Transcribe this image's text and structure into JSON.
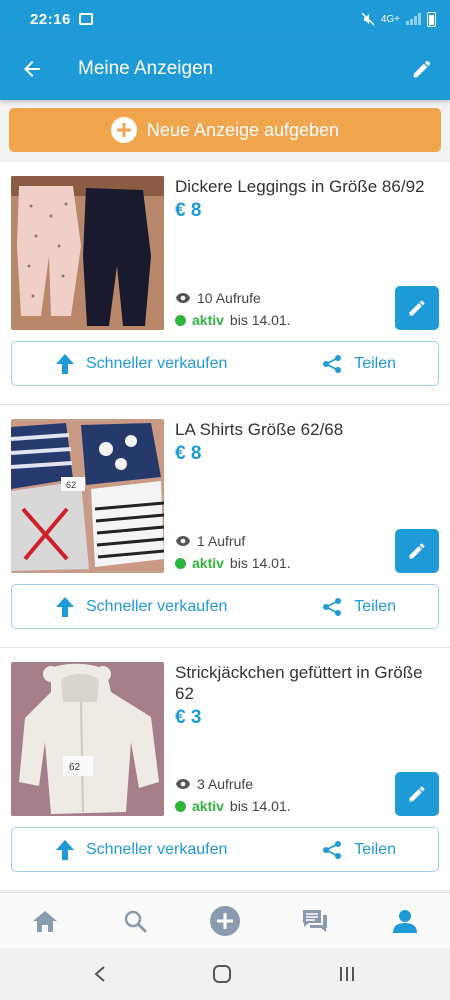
{
  "status_bar": {
    "time": "22:16",
    "network": "4G+"
  },
  "app_bar": {
    "title": "Meine Anzeigen"
  },
  "new_ad_button": {
    "label": "Neue Anzeige aufgeben"
  },
  "colors": {
    "primary": "#1e9ad6",
    "accent_orange": "#f0a44b",
    "active_green": "#2fb53b"
  },
  "ads": [
    {
      "title": "Dickere Leggings in Größe 86/92",
      "price": "€ 8",
      "views": "10 Aufrufe",
      "status": "aktiv",
      "until": "bis 14.01.",
      "sell_label": "Schneller verkaufen",
      "share_label": "Teilen"
    },
    {
      "title": "LA Shirts Größe 62/68",
      "price": "€ 8",
      "views": "1 Aufruf",
      "status": "aktiv",
      "until": "bis 14.01.",
      "sell_label": "Schneller verkaufen",
      "share_label": "Teilen",
      "photo_tag": "62"
    },
    {
      "title": "Strickjäckchen gefüttert in Größe 62",
      "price": "€ 3",
      "views": "3 Aufrufe",
      "status": "aktiv",
      "until": "bis 14.01.",
      "sell_label": "Schneller verkaufen",
      "share_label": "Teilen",
      "photo_tag": "62"
    }
  ],
  "bottom_nav": {
    "items": [
      "home-icon",
      "search-icon",
      "add-icon",
      "messages-icon",
      "profile-icon"
    ],
    "active": "profile-icon"
  }
}
